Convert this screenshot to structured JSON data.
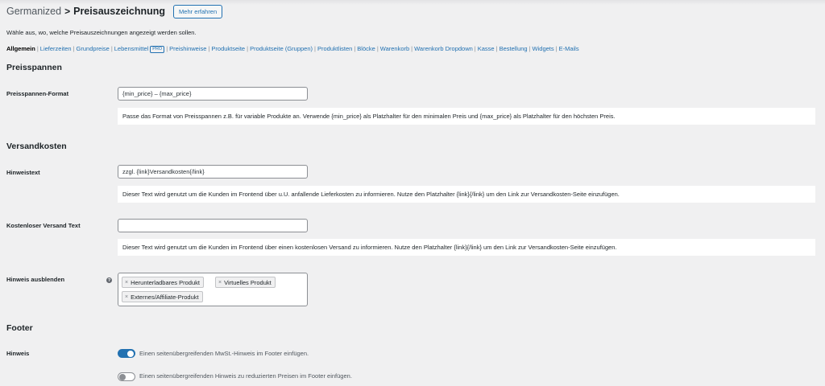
{
  "header": {
    "parent": "Germanized",
    "separator": ">",
    "title": "Preisauszeichnung",
    "more_button": "Mehr erfahren"
  },
  "intro": "Wähle aus, wo, welche Preisauszeichnungen angezeigt werden sollen.",
  "subnav": {
    "items": [
      {
        "label": "Allgemein",
        "current": true
      },
      {
        "label": "Lieferzeiten"
      },
      {
        "label": "Grundpreise"
      },
      {
        "label": "Lebensmittel",
        "badge": "PRO"
      },
      {
        "label": "Preishinweise"
      },
      {
        "label": "Produktseite"
      },
      {
        "label": "Produktseite (Gruppen)"
      },
      {
        "label": "Produktlisten"
      },
      {
        "label": "Blöcke"
      },
      {
        "label": "Warenkorb"
      },
      {
        "label": "Warenkorb Dropdown"
      },
      {
        "label": "Kasse"
      },
      {
        "label": "Bestellung"
      },
      {
        "label": "Widgets"
      },
      {
        "label": "E-Mails"
      }
    ],
    "separator": "|"
  },
  "sections": {
    "price_range": {
      "title": "Preisspannen",
      "format_label": "Preisspannen-Format",
      "format_value": "{min_price} – {max_price}",
      "format_desc": "Passe das Format von Preisspannen z.B. für variable Produkte an. Verwende {min_price} als Platzhalter für den minimalen Preis und {max_price} als Platzhalter für den höchsten Preis."
    },
    "shipping": {
      "title": "Versandkosten",
      "notice_label": "Hinweistext",
      "notice_value": "zzgl. {link}Versandkosten{/link}",
      "notice_desc": "Dieser Text wird genutzt um die Kunden im Frontend über u.U. anfallende Lieferkosten zu informieren. Nutze den Platzhalter {link}{/link} um den Link zur Versandkosten-Seite einzufügen.",
      "free_label": "Kostenloser Versand Text",
      "free_value": "",
      "free_desc": "Dieser Text wird genutzt um die Kunden im Frontend über einen kostenlosen Versand zu informieren. Nutze den Platzhalter {link}{/link} um den Link zur Versandkosten-Seite einzufügen.",
      "hide_label": "Hinweis ausblenden",
      "help_icon": "?",
      "hide_tags": [
        "Herunterladbares Produkt",
        "Virtuelles Produkt",
        "Externes/Affiliate-Produkt"
      ],
      "tag_remove": "×"
    },
    "footer": {
      "title": "Footer",
      "notice_label": "Hinweis",
      "toggle1_text": "Einen seitenübergreifenden MwSt.-Hinweis im Footer einfügen.",
      "toggle1_on": true,
      "toggle2_text": "Einen seitenübergreifenden Hinweis zu reduzierten Preisen im Footer einfügen.",
      "toggle2_on": false
    }
  },
  "colors": {
    "accent": "#2271b1",
    "background": "#f0f0f1"
  }
}
